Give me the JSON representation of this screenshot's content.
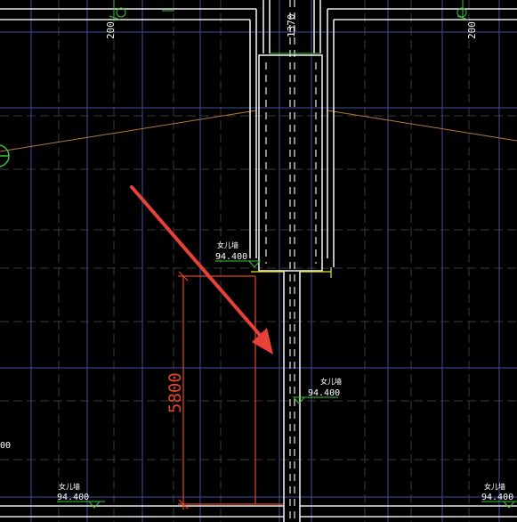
{
  "drawing": {
    "background_color": "#000000",
    "colors": {
      "wall_white": "#e8e8e8",
      "wall_yellow": "#e6e632",
      "grid_blue": "#3c4fa0",
      "grid_gray": "#3a3a3a",
      "axis_orange": "#b8783c",
      "dimension_red": "#e0452a",
      "arrow_red": "#e8413a",
      "level_green": "#39c23a",
      "text_white": "#ffffff"
    },
    "dimensions": {
      "top_left_dim": "200",
      "top_right_dim": "200",
      "shaft_width_dim": "1370",
      "span_dim": "5800",
      "left_edge_partial": "00"
    },
    "level_marks": [
      {
        "id": "mark_center_top",
        "label": "女儿墙",
        "elevation": "94.400"
      },
      {
        "id": "mark_center_mid",
        "label": "女儿墙",
        "elevation": "94.400"
      },
      {
        "id": "mark_bottom_left",
        "label": "女儿墙",
        "elevation": "94.400"
      },
      {
        "id": "mark_bottom_right",
        "label": "女儿墙",
        "elevation": "94.400"
      }
    ],
    "annotation_arrow": {
      "color": "#e8413a",
      "icon": "pointer-arrow"
    }
  }
}
